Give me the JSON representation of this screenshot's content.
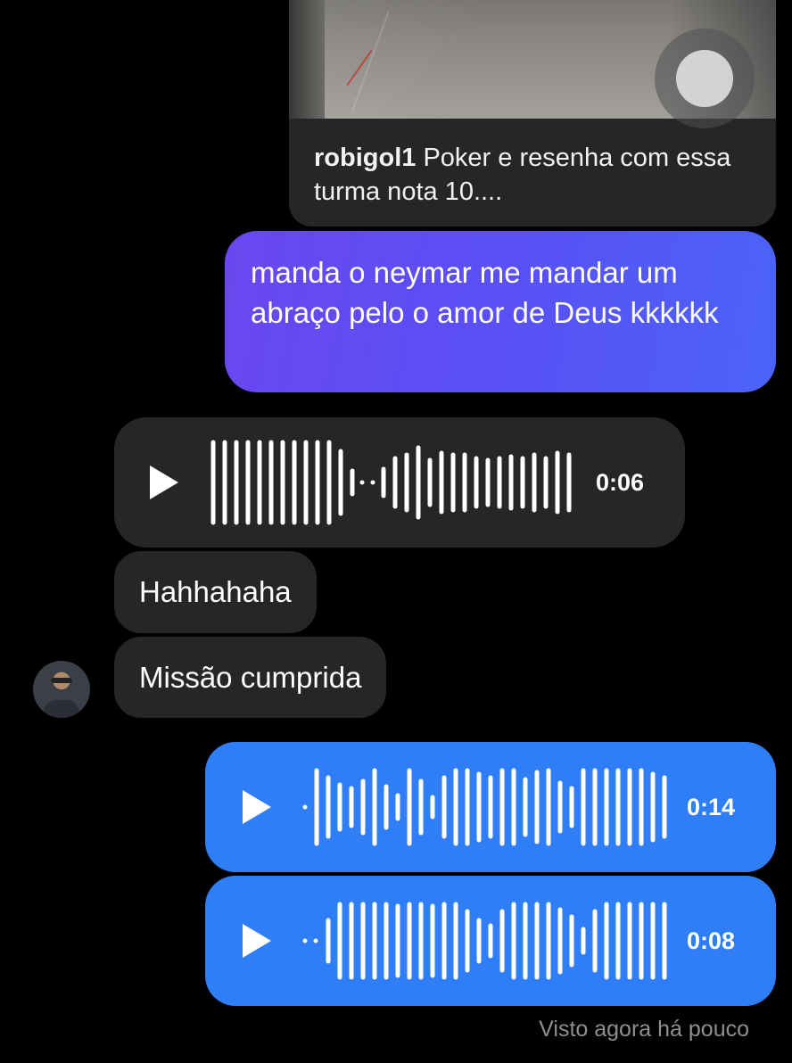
{
  "post": {
    "username": "robigol1",
    "caption": "Poker e resenha com essa turma nota 10...."
  },
  "messages": {
    "outgoing_text": "manda o neymar me mandar um abraço pelo o amor de Deus kkkkkk",
    "incoming_audio": {
      "duration": "0:06"
    },
    "incoming_text_1": "Hahhahaha",
    "incoming_text_2": "Missão cumprida",
    "outgoing_audio_1": {
      "duration": "0:14"
    },
    "outgoing_audio_2": {
      "duration": "0:08"
    }
  },
  "status": {
    "seen": "Visto agora há pouco"
  },
  "icons": {
    "play": "play-icon",
    "video": "video-play-icon"
  },
  "colors": {
    "incoming_bubble": "#262628",
    "outgoing_audio_bubble": "#2f7ef5",
    "outgoing_text_gradient_start": "#6a47ee",
    "outgoing_text_gradient_end": "#4b63f7",
    "seen_text": "#8e8e93"
  }
}
